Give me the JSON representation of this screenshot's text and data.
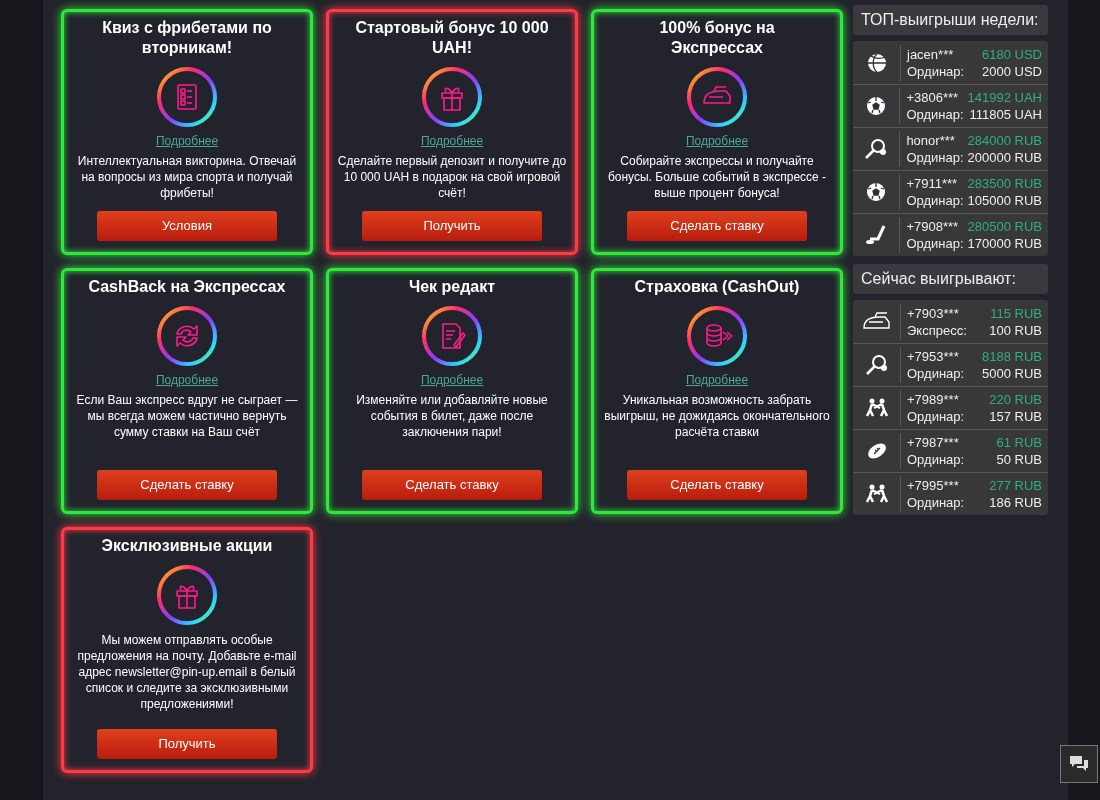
{
  "promotions": [
    {
      "title": "Квиз с фрибетами по вторникам!",
      "color": "#2ee83a",
      "details_link": "Подробнее",
      "description": "Интеллектуальная викторина. Отвечай на вопросы из мира спорта и получай фрибеты!",
      "button": "Условия"
    },
    {
      "title": "Стартовый бонус 10 000 UAH!",
      "color": "#ff3a44",
      "details_link": "Подробнее",
      "description": "Сделайте первый депозит и получите до 10 000 UAH в подарок на свой игровой счёт!",
      "button": "Получить"
    },
    {
      "title": "100% бонус на Экспрессах",
      "color": "#2ee83a",
      "details_link": "Подробнее",
      "description": "Собирайте экспрессы и получайте бонусы. Больше событий в экспрессе - выше процент бонуса!",
      "button": "Сделать ставку"
    },
    {
      "title": "CashBack на Экспрессах",
      "color": "#2ee83a",
      "details_link": "Подробнее",
      "description": "Если Ваш экспресс вдруг не сыграет — мы всегда можем частично вернуть сумму ставки на Ваш счёт",
      "button": "Сделать ставку"
    },
    {
      "title": "Чек редакт",
      "color": "#2ee83a",
      "details_link": "Подробнее",
      "description": "Изменяйте или добавляйте новые события в билет, даже после заключения пари!",
      "button": "Сделать ставку"
    },
    {
      "title": "Страховка (CashOut)",
      "color": "#2ee83a",
      "details_link": "Подробнее",
      "description": "Уникальная возможность забрать выигрыш, не дожидаясь окончательного расчёта ставки",
      "button": "Сделать ставку"
    },
    {
      "title": "Эксклюзивные акции",
      "color": "#ff3a44",
      "description": "Мы можем отправлять особые предложения на почту. Добавьте e-mail адрес newsletter@pin-up.email в белый список и следите за эксклюзивными предложениями!",
      "button": "Получить"
    }
  ],
  "top_wins": {
    "title": "ТОП-выигрыши недели:",
    "rows": [
      {
        "user": "jacen***",
        "amount": "6180 USD",
        "bet_type": "Ординар:",
        "stake": "2000 USD"
      },
      {
        "user": "+3806***",
        "amount": "141992 UAH",
        "bet_type": "Ординар:",
        "stake": "111805 UAH"
      },
      {
        "user": "honor***",
        "amount": "284000 RUB",
        "bet_type": "Ординар:",
        "stake": "200000 RUB"
      },
      {
        "user": "+7911***",
        "amount": "283500 RUB",
        "bet_type": "Ординар:",
        "stake": "105000 RUB"
      },
      {
        "user": "+7908***",
        "amount": "280500 RUB",
        "bet_type": "Ординар:",
        "stake": "170000 RUB"
      }
    ]
  },
  "live_wins": {
    "title": "Сейчас выигрывают:",
    "rows": [
      {
        "user": "+7903***",
        "amount": "115 RUB",
        "bet_type": "Экспресс:",
        "stake": "100 RUB"
      },
      {
        "user": "+7953***",
        "amount": "8188 RUB",
        "bet_type": "Ординар:",
        "stake": "5000 RUB"
      },
      {
        "user": "+7989***",
        "amount": "220 RUB",
        "bet_type": "Ординар:",
        "stake": "157 RUB"
      },
      {
        "user": "+7987***",
        "amount": "61 RUB",
        "bet_type": "Ординар:",
        "stake": "50 RUB"
      },
      {
        "user": "+7995***",
        "amount": "277 RUB",
        "bet_type": "Ординар:",
        "stake": "186 RUB"
      }
    ]
  }
}
